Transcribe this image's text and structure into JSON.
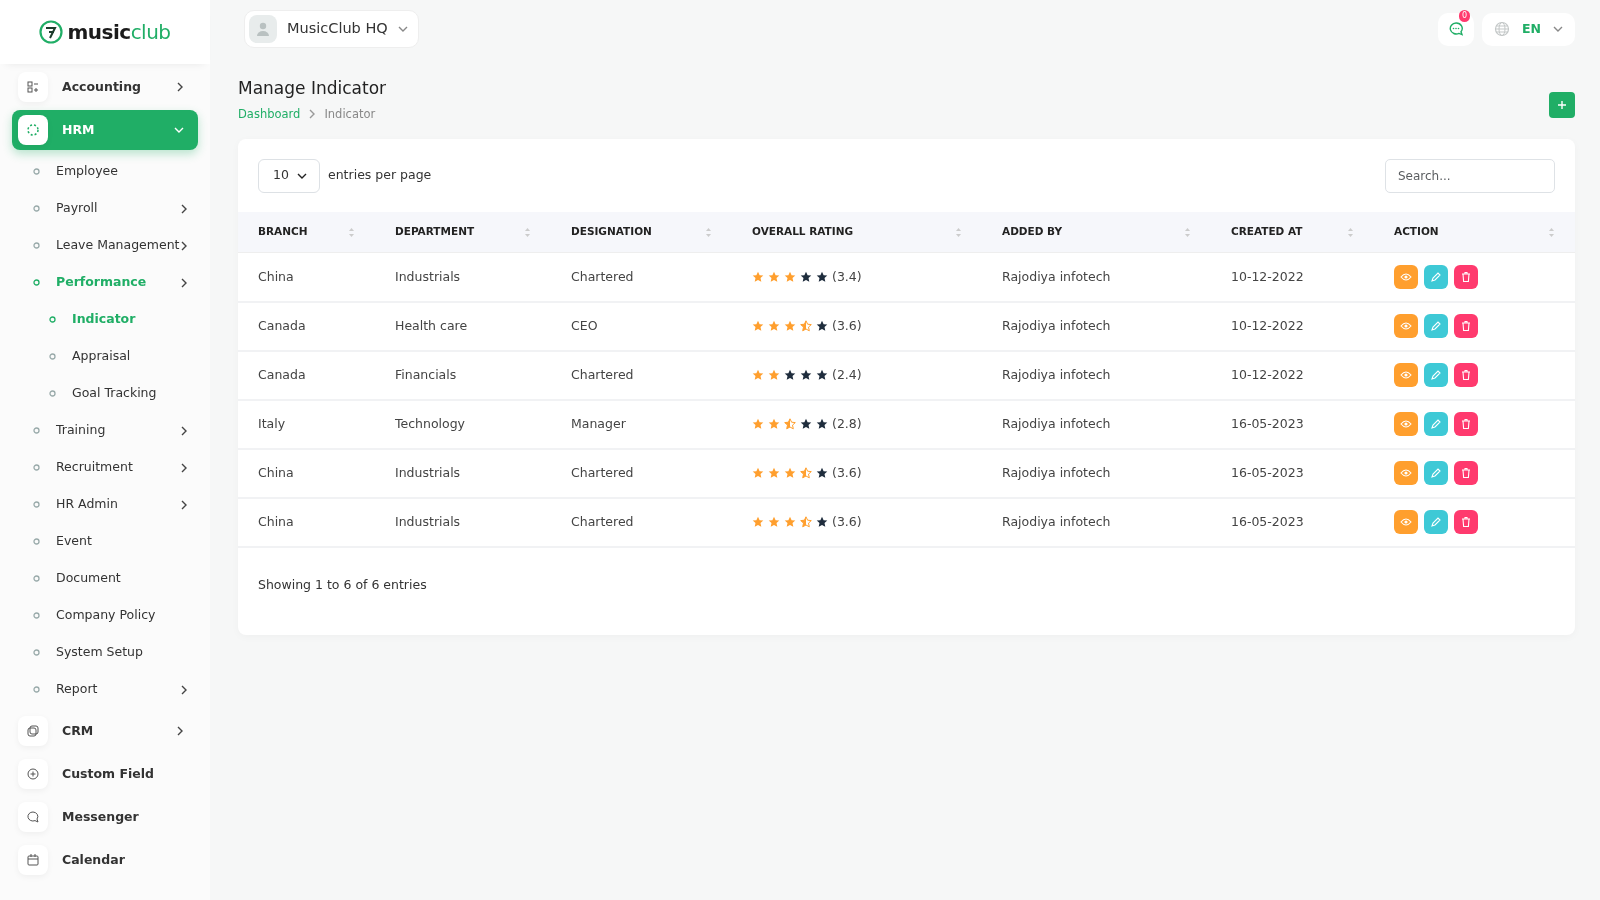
{
  "brand": {
    "name_part1": "music",
    "name_part2": "club"
  },
  "workspace": {
    "name": "MusicClub HQ"
  },
  "header": {
    "notification_count": "0",
    "language": "EN"
  },
  "sidebar": {
    "items": [
      {
        "label": "Accounting",
        "selected": false,
        "expanded": false,
        "has_submenu": true
      },
      {
        "label": "HRM",
        "selected": true,
        "expanded": true,
        "has_submenu": true,
        "children": [
          {
            "label": "Employee",
            "selected": false,
            "has_submenu": false
          },
          {
            "label": "Payroll",
            "selected": false,
            "has_submenu": true
          },
          {
            "label": "Leave Management",
            "selected": false,
            "has_submenu": true
          },
          {
            "label": "Performance",
            "selected": true,
            "has_submenu": true,
            "children": [
              {
                "label": "Indicator",
                "selected": true,
                "has_submenu": false
              },
              {
                "label": "Appraisal",
                "selected": false,
                "has_submenu": false
              },
              {
                "label": "Goal Tracking",
                "selected": false,
                "has_submenu": false
              }
            ]
          },
          {
            "label": "Training",
            "selected": false,
            "has_submenu": true
          },
          {
            "label": "Recruitment",
            "selected": false,
            "has_submenu": true
          },
          {
            "label": "HR Admin",
            "selected": false,
            "has_submenu": true
          },
          {
            "label": "Event",
            "selected": false,
            "has_submenu": false
          },
          {
            "label": "Document",
            "selected": false,
            "has_submenu": false
          },
          {
            "label": "Company Policy",
            "selected": false,
            "has_submenu": false
          },
          {
            "label": "System Setup",
            "selected": false,
            "has_submenu": false
          },
          {
            "label": "Report",
            "selected": false,
            "has_submenu": true
          }
        ]
      },
      {
        "label": "CRM",
        "selected": false,
        "expanded": false,
        "has_submenu": true
      },
      {
        "label": "Custom Field",
        "selected": false,
        "has_submenu": false
      },
      {
        "label": "Messenger",
        "selected": false,
        "has_submenu": false
      },
      {
        "label": "Calendar",
        "selected": false,
        "has_submenu": false
      }
    ]
  },
  "page": {
    "title": "Manage Indicator",
    "breadcrumb": [
      {
        "label": "Dashboard",
        "selected": false
      },
      {
        "label": "Indicator",
        "selected": true
      }
    ]
  },
  "table": {
    "page_size": "10",
    "page_size_label": "entries per page",
    "search": {
      "placeholder": "Search..."
    },
    "columns": [
      "BRANCH",
      "DEPARTMENT",
      "DESIGNATION",
      "OVERALL RATING",
      "ADDED BY",
      "CREATED AT",
      "ACTION"
    ],
    "rows": [
      {
        "branch": "China",
        "department": "Industrials",
        "designation": "Chartered",
        "stars": 3,
        "rating": "(3.4)",
        "added_by": "Rajodiya infotech",
        "created_at": "10-12-2022"
      },
      {
        "branch": "Canada",
        "department": "Health care",
        "designation": "CEO",
        "stars": 3.5,
        "rating": "(3.6)",
        "added_by": "Rajodiya infotech",
        "created_at": "10-12-2022"
      },
      {
        "branch": "Canada",
        "department": "Financials",
        "designation": "Chartered",
        "stars": 2,
        "rating": "(2.4)",
        "added_by": "Rajodiya infotech",
        "created_at": "10-12-2022"
      },
      {
        "branch": "Italy",
        "department": "Technology",
        "designation": "Manager",
        "stars": 2.5,
        "rating": "(2.8)",
        "added_by": "Rajodiya infotech",
        "created_at": "16-05-2023"
      },
      {
        "branch": "China",
        "department": "Industrials",
        "designation": "Chartered",
        "stars": 3.5,
        "rating": "(3.6)",
        "added_by": "Rajodiya infotech",
        "created_at": "16-05-2023"
      },
      {
        "branch": "China",
        "department": "Industrials",
        "designation": "Chartered",
        "stars": 3.5,
        "rating": "(3.6)",
        "added_by": "Rajodiya infotech",
        "created_at": "16-05-2023"
      }
    ],
    "footer": "Showing 1 to 6 of 6 entries"
  }
}
